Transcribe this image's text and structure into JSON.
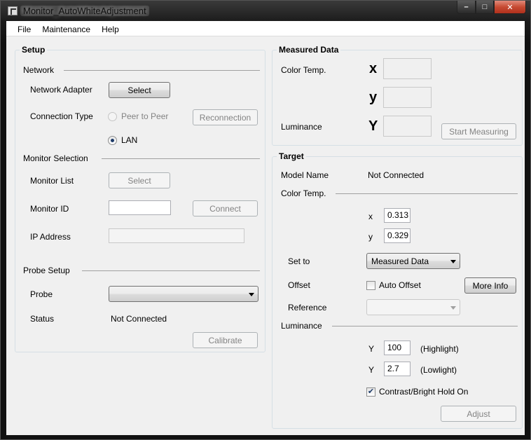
{
  "window": {
    "title": "Monitor_AutoWhiteAdjustment",
    "caption_min": "–",
    "caption_max": "□",
    "caption_close": "✕"
  },
  "menu": [
    "File",
    "Maintenance",
    "Help"
  ],
  "setup": {
    "title": "Setup",
    "network": {
      "heading": "Network",
      "adapter_label": "Network Adapter",
      "adapter_button": "Select",
      "connection_type_label": "Connection Type",
      "option_p2p": "Peer to Peer",
      "option_lan": "LAN",
      "reconnection_button": "Reconnection"
    },
    "monitor_selection": {
      "heading": "Monitor Selection",
      "monitor_list_label": "Monitor List",
      "monitor_list_button": "Select",
      "monitor_id_label": "Monitor ID",
      "monitor_id_value": "",
      "connect_button": "Connect",
      "ip_address_label": "IP Address",
      "ip_address_value": ""
    },
    "probe_setup": {
      "heading": "Probe Setup",
      "probe_label": "Probe",
      "probe_value": "",
      "status_label": "Status",
      "status_value": "Not Connected",
      "calibrate_button": "Calibrate"
    }
  },
  "measured": {
    "title": "Measured Data",
    "color_temp_label": "Color Temp.",
    "x_symbol": "x",
    "y_symbol": "y",
    "luminance_label": "Luminance",
    "Y_symbol": "Y",
    "start_button": "Start Measuring"
  },
  "target": {
    "title": "Target",
    "model_name_label": "Model Name",
    "model_name_value": "Not Connected",
    "color_temp_heading": "Color Temp.",
    "x_label": "x",
    "x_value": "0.313",
    "y_label": "y",
    "y_value": "0.329",
    "set_to_label": "Set to",
    "set_to_value": "Measured Data",
    "offset_label": "Offset",
    "auto_offset_label": "Auto Offset",
    "more_info_button": "More Info",
    "reference_label": "Reference",
    "reference_value": "",
    "luminance_heading": "Luminance",
    "y_high_label": "Y",
    "y_high_value": "100",
    "y_high_desc": "(Highlight)",
    "y_low_label": "Y",
    "y_low_value": "2.7",
    "y_low_desc": "(Lowlight)",
    "contrast_hold_label": "Contrast/Bright Hold On",
    "contrast_hold_checked": "✔",
    "adjust_button": "Adjust"
  }
}
